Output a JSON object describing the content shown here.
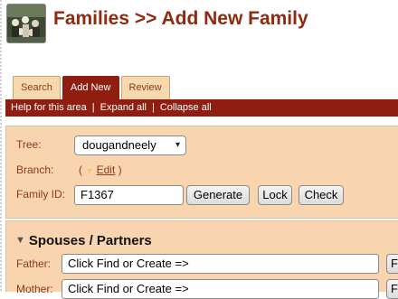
{
  "header": {
    "title": "Families >> Add New Family",
    "logo_icon": "family-photo-icon"
  },
  "tabs": [
    {
      "label": "Search"
    },
    {
      "label": "Add New",
      "active": true
    },
    {
      "label": "Review"
    }
  ],
  "menubar": {
    "help": "Help for this area",
    "expand": "Expand all",
    "collapse": "Collapse all",
    "separator": "|"
  },
  "form": {
    "tree_label": "Tree:",
    "tree_value": "dougandneely",
    "branch_label": "Branch:",
    "branch_open": "(",
    "branch_edit": "Edit",
    "branch_close": ")",
    "family_id_label": "Family ID:",
    "family_id_value": "F1367",
    "generate_label": "Generate",
    "lock_label": "Lock",
    "check_label": "Check"
  },
  "spouses": {
    "heading": "Spouses / Partners",
    "father_label": "Father:",
    "father_value": "Click Find or Create =>",
    "mother_label": "Mother:",
    "mother_value": "Click Find or Create =>",
    "find_label": "Fi"
  },
  "colors": {
    "brand": "#8f2a10",
    "menubar": "#8f1d10",
    "panel": "#f8d5ae",
    "tab": "#f8d9ae"
  }
}
